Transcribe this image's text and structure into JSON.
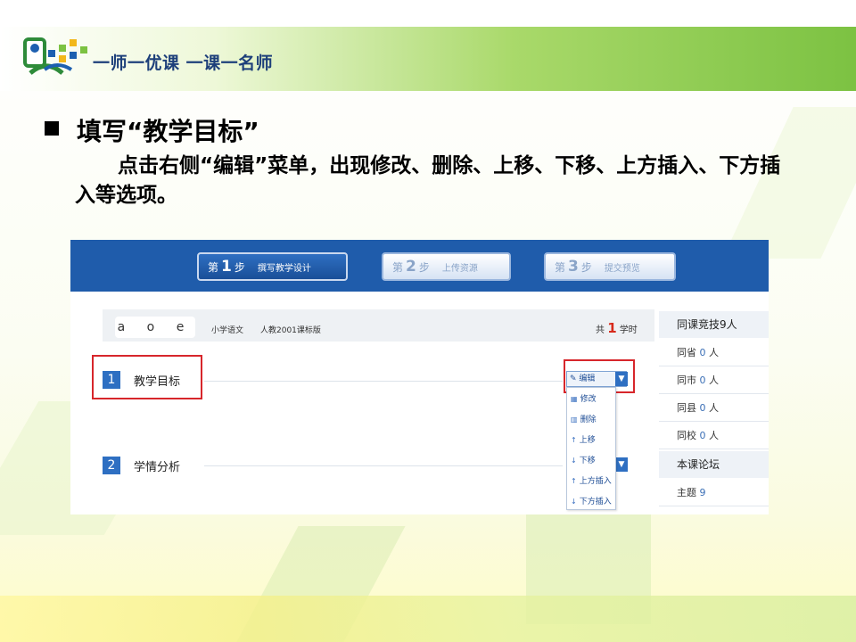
{
  "slide": {
    "slogan": "一师一优课 一课一名师",
    "heading": "填写“教学目标”",
    "body": "点击右侧“编辑”菜单，出现修改、删除、上移、下移、上方插入、下方插入等选项。",
    "colors": {
      "banner_green": "#7cc242",
      "step_blue": "#1f5cab",
      "highlight_red": "#d7262b"
    }
  },
  "screenshot": {
    "steps": [
      {
        "prefix": "第",
        "num": "1",
        "suffix": "步",
        "label": "撰写教学设计",
        "active": true
      },
      {
        "prefix": "第",
        "num": "2",
        "suffix": "步",
        "label": "上传资源",
        "active": false
      },
      {
        "prefix": "第",
        "num": "3",
        "suffix": "步",
        "label": "提交预览",
        "active": false
      }
    ],
    "course": {
      "name": "a o e",
      "subject": "小学语文",
      "edition": "人教2001课标版",
      "hours_prefix": "共",
      "hours_num": "1",
      "hours_suffix": "学时"
    },
    "sections": [
      {
        "num": "1",
        "label": "教学目标"
      },
      {
        "num": "2",
        "label": "学情分析"
      }
    ],
    "edit_menu": {
      "button_label": "编辑",
      "items": [
        "修改",
        "删除",
        "上移",
        "下移",
        "上方插入",
        "下方插入"
      ]
    },
    "sidebar": {
      "competition_title": "同课竞技9人",
      "stats": [
        {
          "label": "同省",
          "count": "0",
          "unit": "人"
        },
        {
          "label": "同市",
          "count": "0",
          "unit": "人"
        },
        {
          "label": "同县",
          "count": "0",
          "unit": "人"
        },
        {
          "label": "同校",
          "count": "0",
          "unit": "人"
        }
      ],
      "forum_title": "本课论坛",
      "topic_label": "主题",
      "topic_count": "9"
    }
  }
}
